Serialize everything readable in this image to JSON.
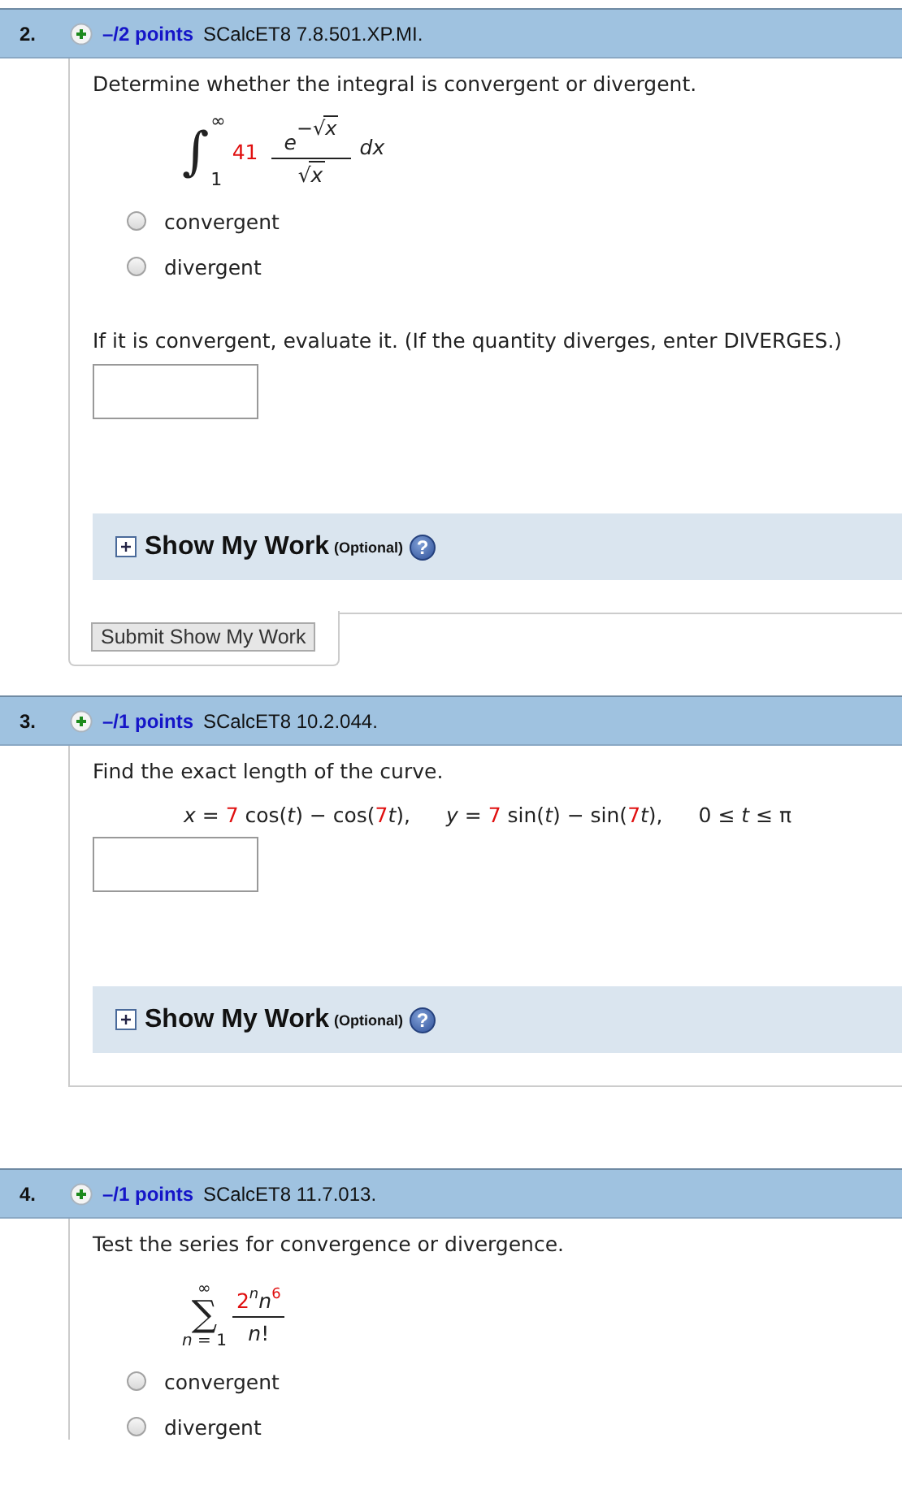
{
  "questions": [
    {
      "number": "2.",
      "points": "–/2 points",
      "code": "SCalcET8 7.8.501.XP.MI.",
      "body": [
        {
          "kind": "prompt",
          "text": "Determine whether the integral is convergent or divergent."
        },
        {
          "kind": "integral",
          "sign": "∫",
          "upper": "∞",
          "lower": "1",
          "coefficient": "41",
          "numerator_base": "e",
          "numerator_exponent_sign": "−",
          "radical": "√",
          "numerator_radicand": "x",
          "denominator_radicand": "x",
          "differential": "dx"
        },
        {
          "kind": "choices",
          "options": [
            {
              "label": "convergent",
              "selected": false
            },
            {
              "label": "divergent",
              "selected": false
            }
          ]
        },
        {
          "kind": "prompt",
          "text": "If it is convergent, evaluate it. (If the quantity diverges, enter DIVERGES.)"
        },
        {
          "kind": "answer"
        },
        {
          "kind": "showwork",
          "title": "Show My Work",
          "note": "(Optional)",
          "help": "?",
          "submit": "Submit Show My Work"
        }
      ]
    },
    {
      "number": "3.",
      "points": "–/1 points",
      "code": "SCalcET8 10.2.044.",
      "body": [
        {
          "kind": "prompt",
          "text": "Find the exact length of the curve."
        },
        {
          "kind": "equations",
          "items": [
            [
              {
                "text": "x",
                "kind": "var"
              },
              {
                "text": " = ",
                "kind": "op"
              },
              {
                "text": "7",
                "kind": "param"
              },
              {
                "text": " cos(",
                "kind": "op"
              },
              {
                "text": "t",
                "kind": "var"
              },
              {
                "text": ") − cos(",
                "kind": "op"
              },
              {
                "text": "7",
                "kind": "param"
              },
              {
                "text": "t",
                "kind": "var"
              },
              {
                "text": "),",
                "kind": "op"
              }
            ],
            [
              {
                "text": "y",
                "kind": "var"
              },
              {
                "text": " = ",
                "kind": "op"
              },
              {
                "text": "7",
                "kind": "param"
              },
              {
                "text": " sin(",
                "kind": "op"
              },
              {
                "text": "t",
                "kind": "var"
              },
              {
                "text": ") − sin(",
                "kind": "op"
              },
              {
                "text": "7",
                "kind": "param"
              },
              {
                "text": "t",
                "kind": "var"
              },
              {
                "text": "),",
                "kind": "op"
              }
            ],
            [
              {
                "text": "0 ≤ ",
                "kind": "op"
              },
              {
                "text": "t",
                "kind": "var"
              },
              {
                "text": " ≤ π",
                "kind": "op"
              }
            ]
          ]
        },
        {
          "kind": "answer"
        },
        {
          "kind": "showwork",
          "title": "Show My Work",
          "note": "(Optional)",
          "help": "?"
        }
      ]
    },
    {
      "number": "4.",
      "points": "–/1 points",
      "code": "SCalcET8 11.7.013.",
      "body": [
        {
          "kind": "prompt",
          "text": "Test the series for convergence or divergence."
        },
        {
          "kind": "series",
          "sign": "∑",
          "upper": "∞",
          "lower": [
            {
              "text": "n",
              "kind": "var"
            },
            {
              "text": " = 1",
              "kind": "op"
            }
          ],
          "numerator": [
            {
              "text": "2",
              "kind": "param"
            },
            {
              "text": "n",
              "kind": "var",
              "raised": true
            },
            {
              "text": "n",
              "kind": "var"
            },
            {
              "text": "6",
              "kind": "param",
              "raised": true
            }
          ],
          "denominator": [
            {
              "text": "n",
              "kind": "var"
            },
            {
              "text": "!",
              "kind": "op"
            }
          ]
        },
        {
          "kind": "choices",
          "options": [
            {
              "label": "convergent",
              "selected": false
            },
            {
              "label": "divergent",
              "selected": false
            }
          ]
        }
      ]
    }
  ]
}
